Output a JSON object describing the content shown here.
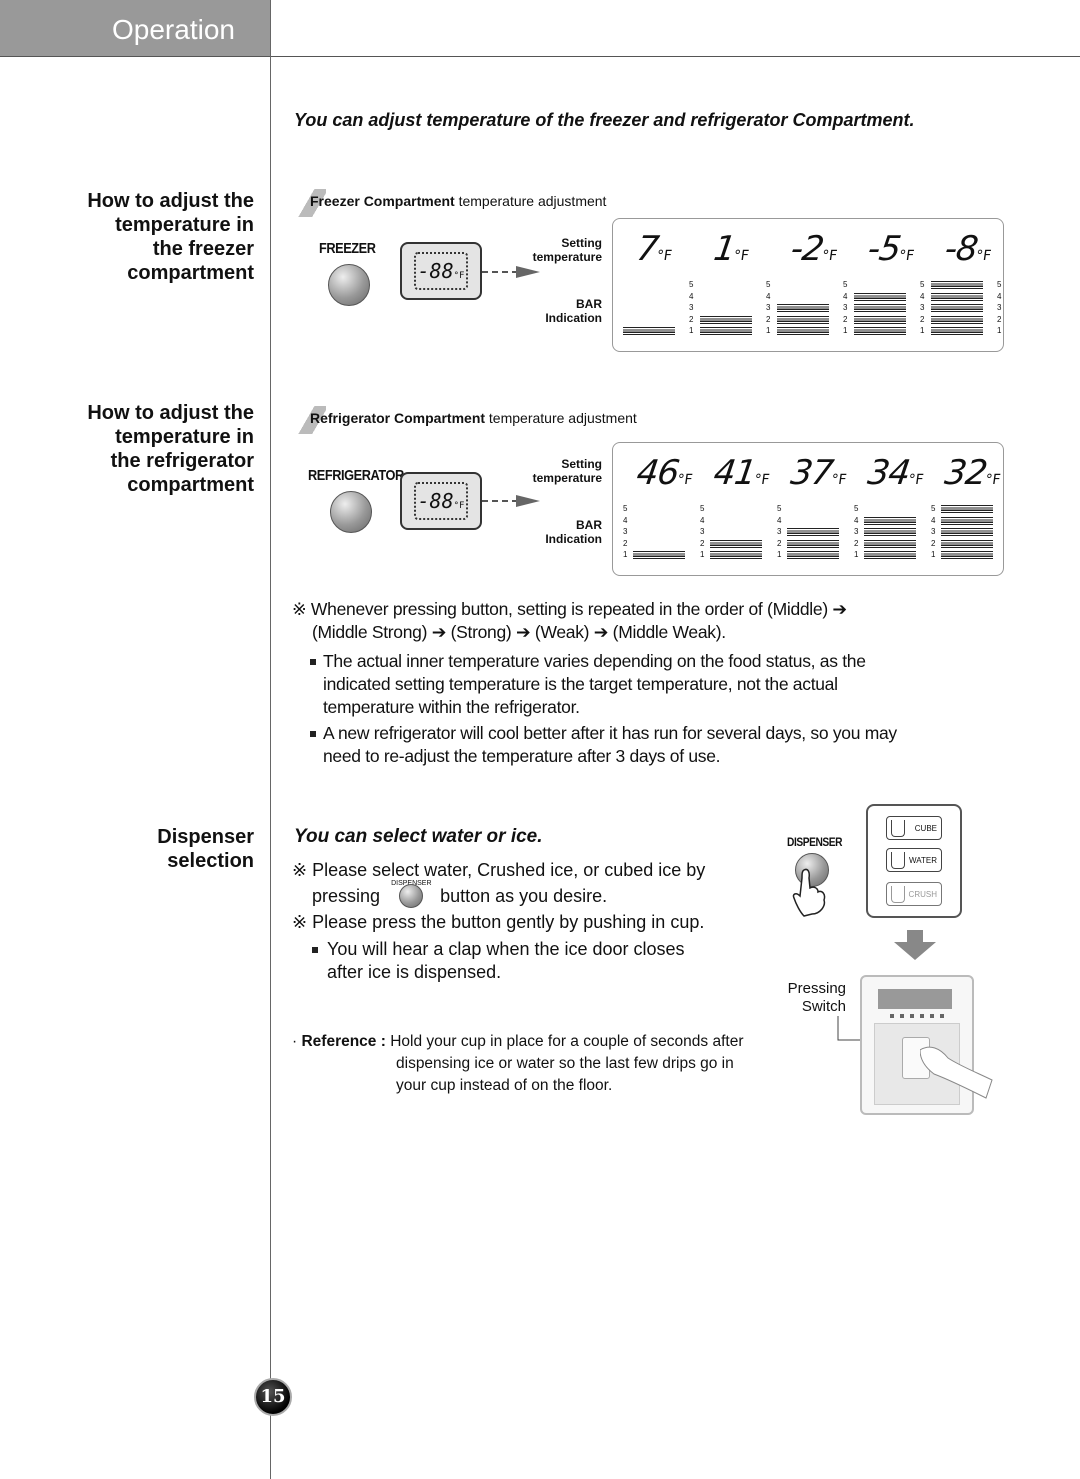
{
  "header": {
    "title": "Operation"
  },
  "sidebar": {
    "freezer_heading": [
      "How to adjust the",
      "temperature in",
      "the freezer",
      "compartment"
    ],
    "fridge_heading": [
      "How to adjust the",
      "temperature in",
      "the refrigerator",
      "compartment"
    ],
    "dispenser_heading": [
      "Dispenser",
      "selection"
    ]
  },
  "intro": "You can adjust temperature of the freezer and refrigerator Compartment.",
  "freezer": {
    "sub_bold": "Freezer Compartment",
    "sub_rest": " temperature adjustment",
    "control_label": "FREEZER",
    "lcd_value": "-88",
    "unit": "°F",
    "setting_label": [
      "Setting",
      "temperature"
    ],
    "bar_label": [
      "BAR",
      "Indication"
    ],
    "settings": [
      {
        "temp": "7",
        "level": 1
      },
      {
        "temp": "1",
        "level": 2
      },
      {
        "temp": "-2",
        "level": 3
      },
      {
        "temp": "-5",
        "level": 4
      },
      {
        "temp": "-8",
        "level": 5
      }
    ]
  },
  "fridge": {
    "sub_bold": "Refrigerator Compartment",
    "sub_rest": " temperature adjustment",
    "control_label": "REFRIGERATOR",
    "lcd_value": "-88",
    "unit": "°F",
    "setting_label": [
      "Setting",
      "temperature"
    ],
    "bar_label": [
      "BAR",
      "Indication"
    ],
    "settings": [
      {
        "temp": "46",
        "level": 1
      },
      {
        "temp": "41",
        "level": 2
      },
      {
        "temp": "37",
        "level": 3
      },
      {
        "temp": "34",
        "level": 4
      },
      {
        "temp": "32",
        "level": 5
      }
    ]
  },
  "level_labels": [
    "5",
    "4",
    "3",
    "2",
    "1"
  ],
  "notes": {
    "order": [
      "※ Whenever pressing button, setting is repeated in the order of (Middle) ➔",
      "(Middle Strong) ➔  (Strong) ➔  (Weak) ➔  (Middle Weak)."
    ],
    "bullet1": [
      "The actual inner temperature varies depending on the food status, as the",
      "indicated setting temperature is the target temperature, not the actual",
      "temperature within the refrigerator."
    ],
    "bullet2": [
      "A new refrigerator will cool better after it has run for several days, so you may",
      "need to re-adjust the temperature after 3 days of use."
    ]
  },
  "dispenser": {
    "heading": "You can select water or ice.",
    "note1_a": "※ Please select water, Crushed ice, or cubed ice by",
    "note1_b_pre": "pressing",
    "note1_b_post": "button as you desire.",
    "inline_btn_label": "DISPENSER",
    "note2": "※ Please press the button gently by pushing in cup.",
    "bullet": [
      "You will hear a clap when the ice door closes",
      "after ice is dispensed."
    ],
    "ref_label": "Reference :",
    "ref_text": [
      "Hold your cup in place for a couple of seconds after",
      "dispensing ice or water so the last few drips go in",
      "your cup instead of on the floor."
    ],
    "control_label": "DISPENSER",
    "options": [
      "CUBE",
      "WATER",
      "CRUSH"
    ],
    "pressing_label": [
      "Pressing",
      "Switch"
    ]
  },
  "page_number": "15"
}
